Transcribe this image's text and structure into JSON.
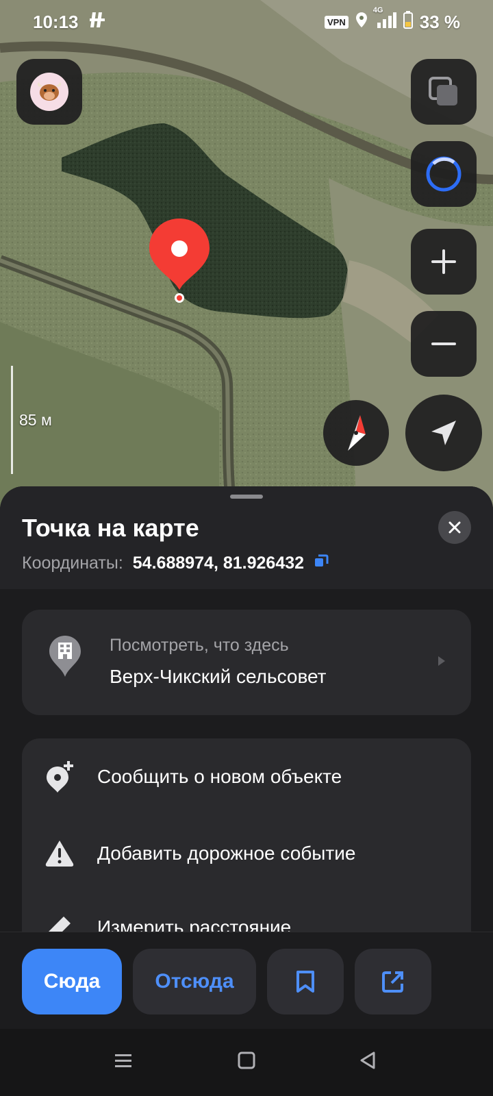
{
  "status_bar": {
    "time": "10:13",
    "vpn": "VPN",
    "network": "4G",
    "battery": "33 %"
  },
  "map": {
    "scale_label": "85 м",
    "colors": {
      "pin": "#f43c34",
      "water": "#2b3a29",
      "field": "#7f8a65"
    }
  },
  "sheet": {
    "title": "Точка на карте",
    "coords_label": "Координаты:",
    "coords_value": "54.688974, 81.926432",
    "whats_here": {
      "subtitle": "Посмотреть, что здесь",
      "title": "Верх-Чикский сельсовет"
    },
    "actions": [
      {
        "label": "Сообщить о новом объекте",
        "icon": "add-place-icon"
      },
      {
        "label": "Добавить дорожное событие",
        "icon": "warning-icon"
      },
      {
        "label": "Измерить расстояние",
        "icon": "ruler-icon"
      }
    ]
  },
  "bottom": {
    "here": "Сюда",
    "from": "Отсюда"
  },
  "colors": {
    "accent": "#3d86f7",
    "sheet_bg": "#1c1c1e",
    "card_bg": "#2a2a2d"
  }
}
